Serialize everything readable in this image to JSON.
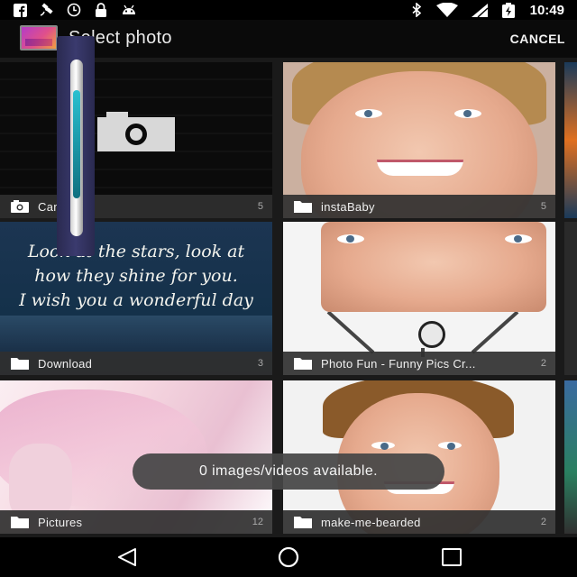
{
  "status_bar": {
    "time": "10:49",
    "left_icons": [
      "facebook-icon",
      "satellite-icon",
      "alarm-icon",
      "lock-icon",
      "android-icon"
    ],
    "right_icons": [
      "bluetooth-icon",
      "wifi-icon",
      "signal-icon",
      "battery-charging-icon"
    ]
  },
  "action_bar": {
    "title": "Select photo",
    "cancel_label": "CANCEL"
  },
  "albums": [
    {
      "name": "Camera",
      "count": "5",
      "icon": "camera-icon"
    },
    {
      "name": "instaBaby",
      "count": "5",
      "icon": "folder-icon"
    },
    {
      "name": "Download",
      "count": "3",
      "icon": "folder-icon"
    },
    {
      "name": "Photo Fun - Funny Pics Cr...",
      "count": "2",
      "icon": "folder-icon"
    },
    {
      "name": "Pictures",
      "count": "12",
      "icon": "folder-icon"
    },
    {
      "name": "make-me-bearded",
      "count": "2",
      "icon": "folder-icon"
    }
  ],
  "quote_image_text": [
    "Look at the stars, look at",
    "how they shine for you.",
    "I wish you a wonderful day"
  ],
  "toast": "0 images/videos available.",
  "nav_bar": [
    "back-icon",
    "home-icon",
    "recents-icon"
  ]
}
